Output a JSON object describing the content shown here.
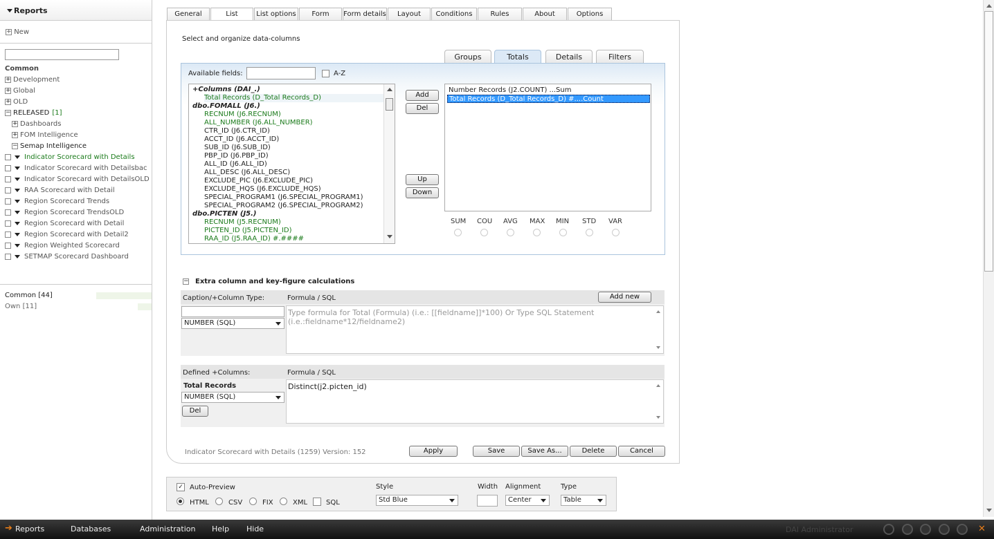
{
  "sidebar": {
    "title": "Reports",
    "new_label": "New",
    "section_label": "Common",
    "tree": [
      {
        "label": "Development",
        "indent": 0,
        "kind": "plus"
      },
      {
        "label": "Global",
        "indent": 0,
        "kind": "plus"
      },
      {
        "label": "OLD",
        "indent": 0,
        "kind": "plus"
      },
      {
        "label": "RELEASED",
        "count": "[1]",
        "indent": 0,
        "kind": "minus"
      },
      {
        "label": "Dashboards",
        "indent": 1,
        "kind": "plus"
      },
      {
        "label": "FOM Intelligence",
        "indent": 1,
        "kind": "plus"
      },
      {
        "label": "Semap Intelligence",
        "indent": 1,
        "kind": "minus"
      },
      {
        "label": "Indicator Scorecard with Details",
        "indent": 0,
        "kind": "report",
        "active": true
      },
      {
        "label": "Indicator Scorecard with Detailsbac",
        "indent": 0,
        "kind": "report"
      },
      {
        "label": "Indicator Scorecard with DetailsOLD",
        "indent": 0,
        "kind": "report"
      },
      {
        "label": "RAA Scorecard with Detail",
        "indent": 0,
        "kind": "report"
      },
      {
        "label": "Region Scorecard Trends",
        "indent": 0,
        "kind": "report"
      },
      {
        "label": "Region Scorecard TrendsOLD",
        "indent": 0,
        "kind": "report"
      },
      {
        "label": "Region Scorecard with Detail",
        "indent": 0,
        "kind": "report"
      },
      {
        "label": "Region Scorecard with Detail2",
        "indent": 0,
        "kind": "report"
      },
      {
        "label": "Region Weighted Scorecard",
        "indent": 0,
        "kind": "report"
      },
      {
        "label": "SETMAP Scorecard Dashboard",
        "indent": 0,
        "kind": "report"
      }
    ],
    "common_count": "Common [44]",
    "own_count": "Own [11]"
  },
  "tabs": [
    "General",
    "List",
    "List options",
    "Form",
    "Form details",
    "Layout",
    "Conditions",
    "Rules",
    "About",
    "Options"
  ],
  "active_tab": "List",
  "main": {
    "heading": "Select and organize data-columns",
    "subtabs": [
      "Groups",
      "Totals",
      "Details",
      "Filters"
    ],
    "available_label": "Available fields:",
    "az_label": "A-Z",
    "fields": [
      {
        "text": "+Columns (DAI_.)",
        "style": "group"
      },
      {
        "text": "Total Records (D_Total Records_D)",
        "style": "field-sel"
      },
      {
        "text": "dbo.FOMALL (J6.)",
        "style": "group"
      },
      {
        "text": "RECNUM (J6.RECNUM)",
        "style": "green"
      },
      {
        "text": "ALL_NUMBER (J6.ALL_NUMBER)",
        "style": "green"
      },
      {
        "text": "CTR_ID (J6.CTR_ID)",
        "style": "plain"
      },
      {
        "text": "ACCT_ID (J6.ACCT_ID)",
        "style": "plain"
      },
      {
        "text": "SUB_ID (J6.SUB_ID)",
        "style": "plain"
      },
      {
        "text": "PBP_ID (J6.PBP_ID)",
        "style": "plain"
      },
      {
        "text": "ALL_ID (J6.ALL_ID)",
        "style": "plain"
      },
      {
        "text": "ALL_DESC (J6.ALL_DESC)",
        "style": "plain"
      },
      {
        "text": "EXCLUDE_PIC (J6.EXCLUDE_PIC)",
        "style": "plain"
      },
      {
        "text": "EXCLUDE_HQS (J6.EXCLUDE_HQS)",
        "style": "plain"
      },
      {
        "text": "SPECIAL_PROGRAM1 (J6.SPECIAL_PROGRAM1)",
        "style": "plain"
      },
      {
        "text": "SPECIAL_PROGRAM2 (J6.SPECIAL_PROGRAM2)",
        "style": "plain"
      },
      {
        "text": "dbo.PICTEN (J5.)",
        "style": "group"
      },
      {
        "text": "RECNUM (J5.RECNUM)",
        "style": "green"
      },
      {
        "text": "PICTEN_ID (J5.PICTEN_ID)",
        "style": "green"
      },
      {
        "text": "RAA_ID (J5.RAA_ID) #.####",
        "style": "green"
      }
    ],
    "buttons": {
      "add": "Add",
      "del": "Del",
      "up": "Up",
      "down": "Down"
    },
    "selected": [
      {
        "text": "Number Records (J2.COUNT) ...Sum",
        "selected": false
      },
      {
        "text": "Total Records (D_Total Records_D) #....Count",
        "selected": true
      }
    ],
    "aggregates": [
      "SUM",
      "COU",
      "AVG",
      "MAX",
      "MIN",
      "STD",
      "VAR"
    ],
    "extra": {
      "title": "Extra column and key-figure calculations",
      "caption_header": "Caption/+Column Type:",
      "formula_header": "Formula / SQL",
      "add_new": "Add new",
      "type_value": "NUMBER (SQL)",
      "formula_placeholder": "Type formula for Total (Formula) (i.e.: [[fieldname]]*100) Or Type SQL Statement (i.e.:fieldname*12/fieldname2)",
      "defined_header": "Defined +Columns:",
      "defined_name": "Total Records",
      "defined_type": "NUMBER (SQL)",
      "defined_formula": "Distinct(j2.picten_id)",
      "del": "Del"
    },
    "footer": {
      "info": "Indicator Scorecard with Details (1259) Version: 152",
      "apply": "Apply",
      "save": "Save",
      "save_as": "Save As...",
      "delete": "Delete",
      "cancel": "Cancel"
    }
  },
  "preview": {
    "auto_preview": "Auto-Preview",
    "formats": [
      "HTML",
      "CSV",
      "FIX",
      "XML"
    ],
    "sql_label": "SQL",
    "style_label": "Style",
    "style_value": "Std Blue",
    "width_label": "Width",
    "alignment_label": "Alignment",
    "alignment_value": "Center",
    "type_label": "Type",
    "type_value": "Table"
  },
  "taskbar": {
    "items": [
      "Reports",
      "Databases",
      "Administration",
      "Help",
      "Hide"
    ],
    "user": "DAI Administrator"
  }
}
